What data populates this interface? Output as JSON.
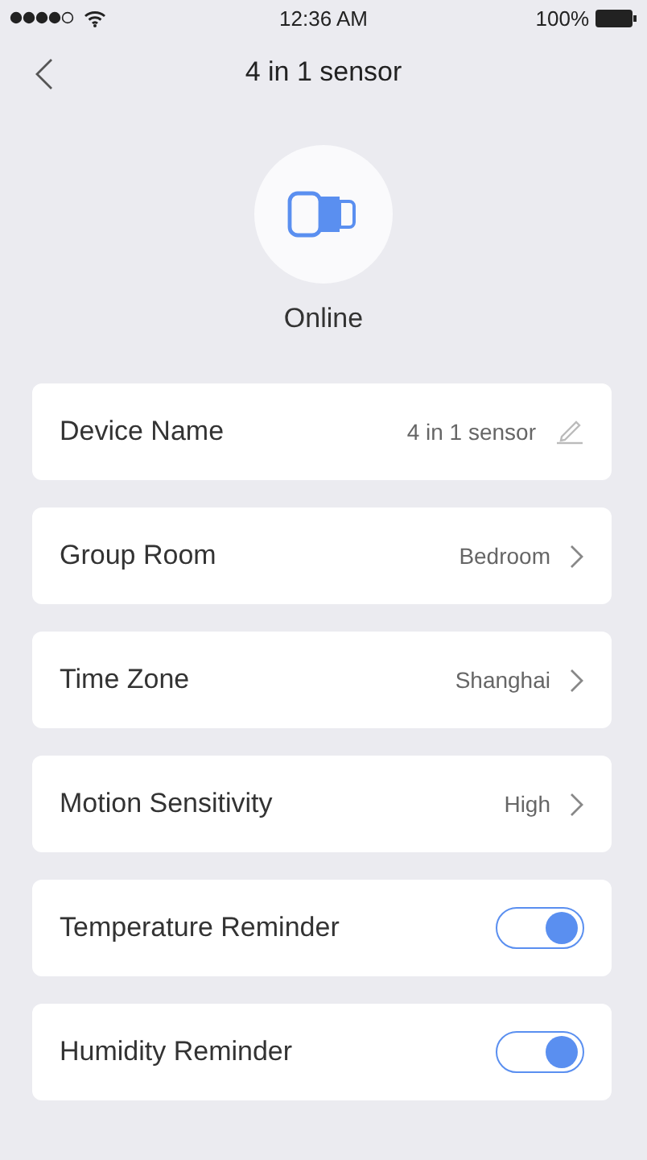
{
  "status_bar": {
    "time": "12:36 AM",
    "battery": "100%"
  },
  "nav": {
    "title": "4 in 1 sensor"
  },
  "device": {
    "status": "Online"
  },
  "settings": [
    {
      "kind": "edit",
      "label": "Device Name",
      "value": "4 in 1 sensor"
    },
    {
      "kind": "link",
      "label": "Group Room",
      "value": "Bedroom"
    },
    {
      "kind": "link",
      "label": "Time Zone",
      "value": "Shanghai"
    },
    {
      "kind": "link",
      "label": "Motion Sensitivity",
      "value": "High"
    },
    {
      "kind": "toggle",
      "label": "Temperature Reminder",
      "on": true
    },
    {
      "kind": "toggle",
      "label": "Humidity Reminder",
      "on": true
    }
  ]
}
